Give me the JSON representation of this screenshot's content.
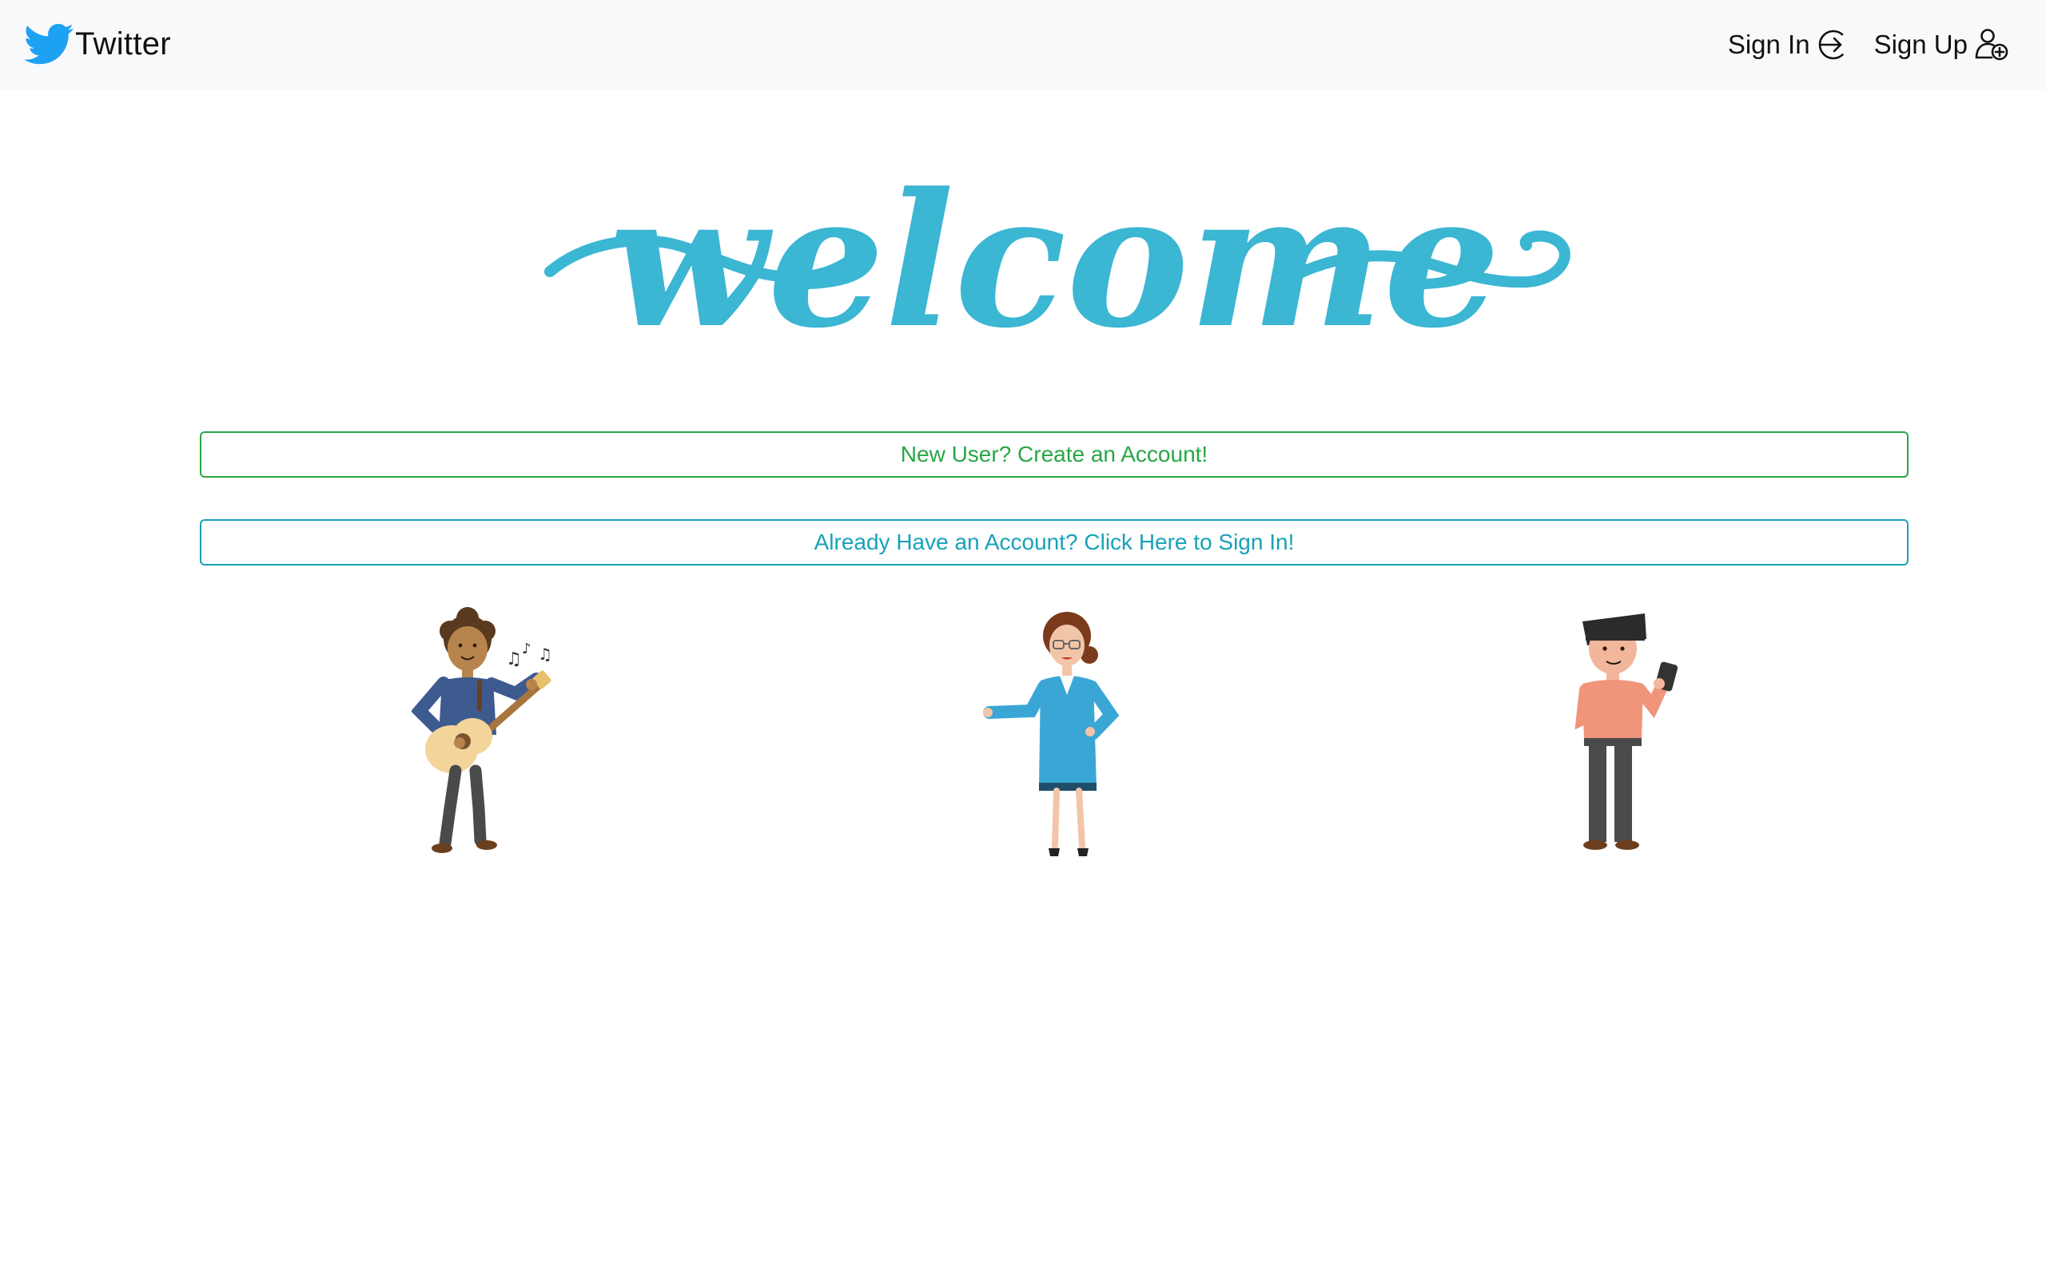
{
  "navbar": {
    "brand_label": "Twitter",
    "brand_icon": "twitter-bird-icon",
    "brand_color": "#1da1f2",
    "links": [
      {
        "label": "Sign In",
        "icon": "sign-in-arrow-icon"
      },
      {
        "label": "Sign Up",
        "icon": "user-plus-icon"
      }
    ]
  },
  "hero": {
    "heading": "welcome",
    "heading_color": "#3bb6d3"
  },
  "actions": {
    "create_account_label": "New User? Create an Account!",
    "sign_in_label": "Already Have an Account? Click Here to Sign In!",
    "create_color": "#28a745",
    "sign_in_color": "#17a2b8"
  },
  "illustrations": [
    {
      "name": "guitar-player"
    },
    {
      "name": "presenting-woman"
    },
    {
      "name": "man-with-phone"
    }
  ]
}
